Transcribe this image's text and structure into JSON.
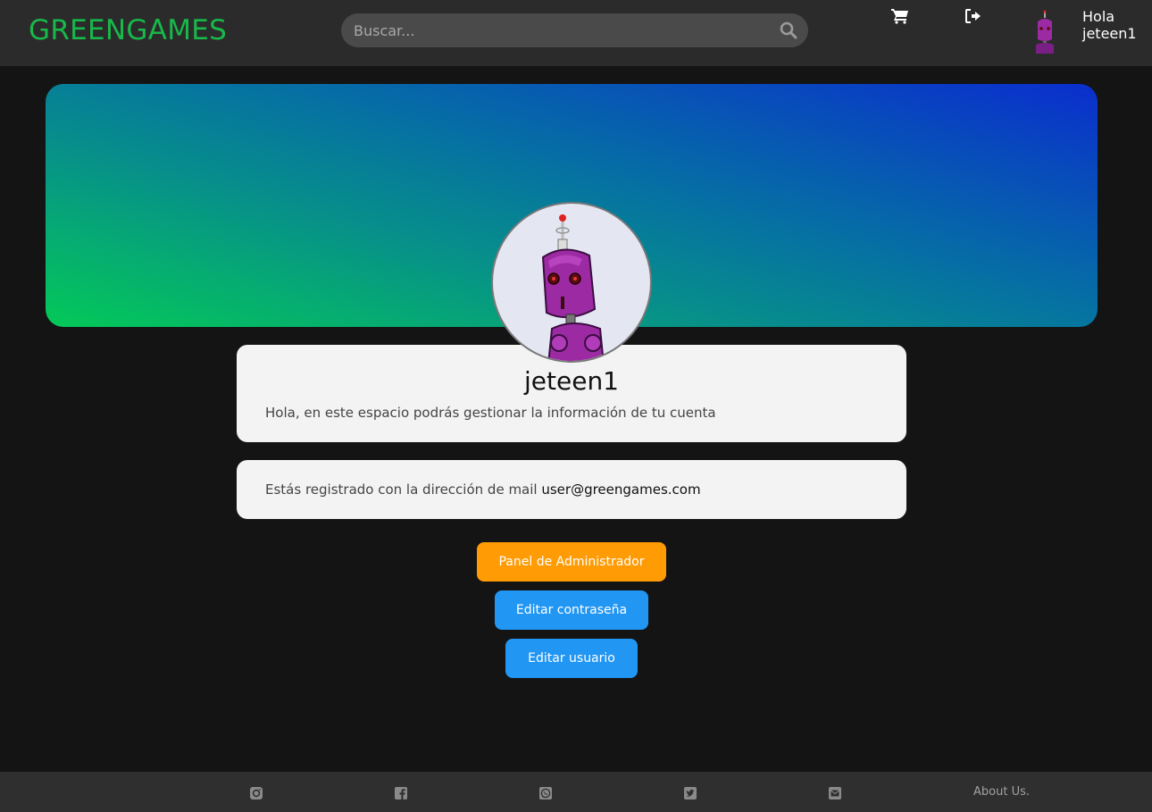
{
  "header": {
    "logo": "GREENGAMES",
    "search_placeholder": "Buscar...",
    "greeting_line1": "Hola",
    "greeting_line2": "jeteen1"
  },
  "profile": {
    "username": "jeteen1",
    "intro": "Hola, en este espacio podrás gestionar la información de tu cuenta",
    "mail_label": "Estás registrado con la dirección de mail",
    "mail_value": "user@greengames.com"
  },
  "actions": {
    "admin_label": "Panel de Administrador",
    "edit_password_label": "Editar contraseña",
    "edit_user_label": "Editar usuario"
  },
  "footer": {
    "icons": [
      "instagram-icon",
      "facebook-icon",
      "whatsapp-icon",
      "twitter-icon",
      "mail-icon"
    ],
    "about_label": "About Us."
  },
  "colors": {
    "brand_green": "#18b84a",
    "admin_orange": "#ff9b05",
    "primary_blue": "#2196f3",
    "background": "#141414"
  }
}
